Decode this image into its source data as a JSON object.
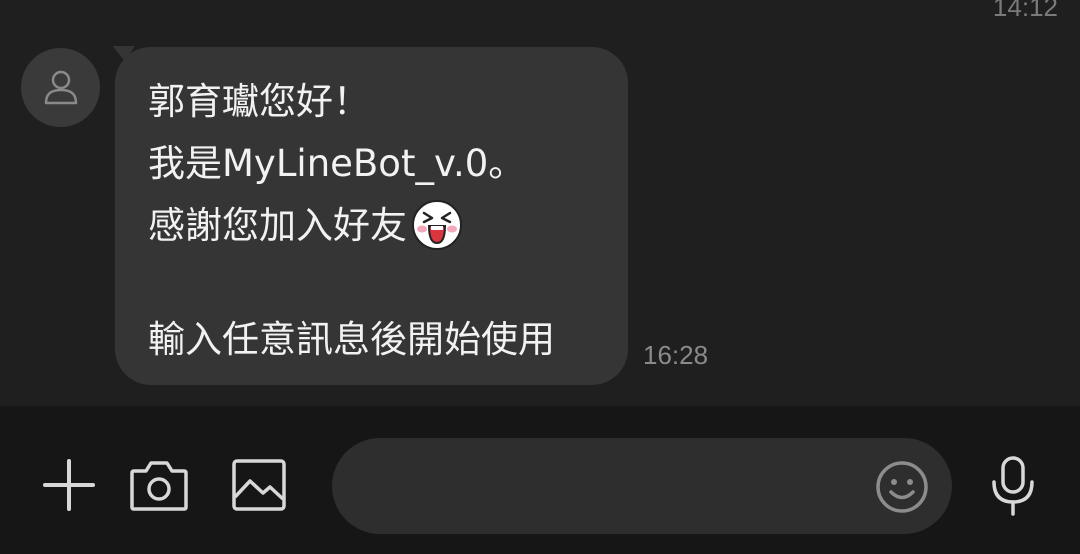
{
  "chat": {
    "previous_timestamp": "14:12",
    "message": {
      "lines": [
        "郭育瓛您好！",
        "我是MyLineBot_v.0。",
        "感謝您加入好友",
        "輸入任意訊息後開始使用"
      ],
      "timestamp": "16:28",
      "emoji": "laughing-sticker-icon"
    },
    "avatar_icon": "person-icon"
  },
  "input_bar": {
    "message_input": {
      "value": "",
      "placeholder": ""
    },
    "icons": [
      "plus-icon",
      "camera-icon",
      "image-icon",
      "smiley-icon",
      "microphone-icon"
    ]
  },
  "colors": {
    "chat_background": "#1f1f1f",
    "bubble": "#353535",
    "input_bar": "#161616",
    "text": "#f2f2f2",
    "timestamp": "#8a8a8a"
  }
}
